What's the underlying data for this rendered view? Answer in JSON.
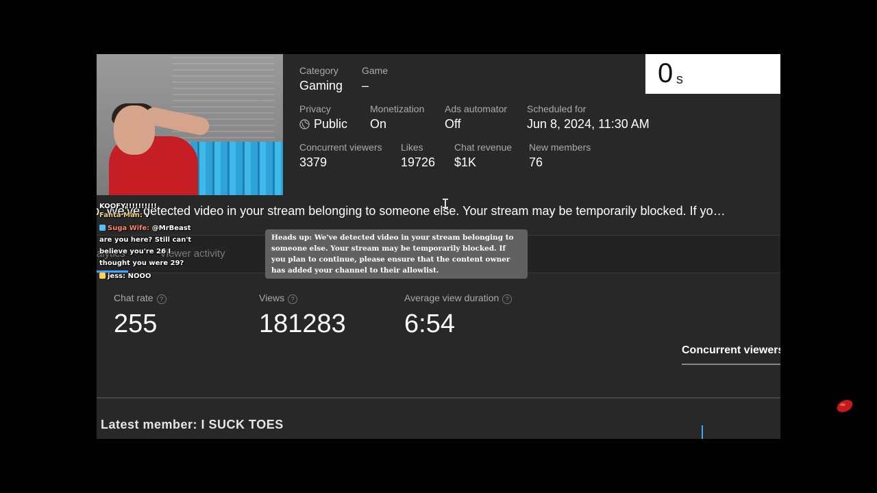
{
  "details": {
    "category_label": "Category",
    "category_value": "Gaming",
    "game_label": "Game",
    "game_value": "–",
    "privacy_label": "Privacy",
    "privacy_value": "Public",
    "monetization_label": "Monetization",
    "monetization_value": "On",
    "ads_label": "Ads automator",
    "ads_value": "Off",
    "scheduled_label": "Scheduled for",
    "scheduled_value": "Jun 8, 2024, 11:30 AM",
    "concurrent_label": "Concurrent viewers",
    "concurrent_value": "3379",
    "likes_label": "Likes",
    "likes_value": "19726",
    "chat_rev_label": "Chat revenue",
    "chat_rev_value": "$1K",
    "new_members_label": "New members",
    "new_members_value": "76"
  },
  "timer": {
    "value": "0",
    "unit": "s"
  },
  "warning_banner": "p. We've detected video in your stream belonging to someone else. Your stream may be temporarily blocked. If yo…",
  "tooltip": "Heads up: We've detected video in your stream belonging to someone else. Your stream may be temporarily blocked. If you plan to continue, please ensure that the content owner has added your channel to their allowlist.",
  "tabs": {
    "analytics_partial": "alytics",
    "viewer_activity": "Viewer activity"
  },
  "stats": {
    "chat_rate_label": "Chat rate",
    "chat_rate_value": "255",
    "views_label": "Views",
    "views_value": "181283",
    "avg_label": "Average view duration",
    "avg_value": "6:54",
    "help_glyph": "?"
  },
  "concurrent_tab": "Concurrent viewers",
  "latest_member": "Latest member: I SUCK TOES",
  "chat": [
    {
      "name": "",
      "text": "KOOFY!!!!!!!!!!"
    },
    {
      "name": "Fanta Man:",
      "text": "v"
    },
    {
      "name": "Suga Wife:",
      "text": "@MrBeast are you here? Still can't believe you're 26 I thought you were 29?"
    },
    {
      "name": "jess:",
      "text": "NOOO"
    }
  ],
  "colors": {
    "accent": "#3ea6ff",
    "panel": "#282828",
    "timer_bg": "#ffffff",
    "tooltip_bg": "#616161"
  }
}
